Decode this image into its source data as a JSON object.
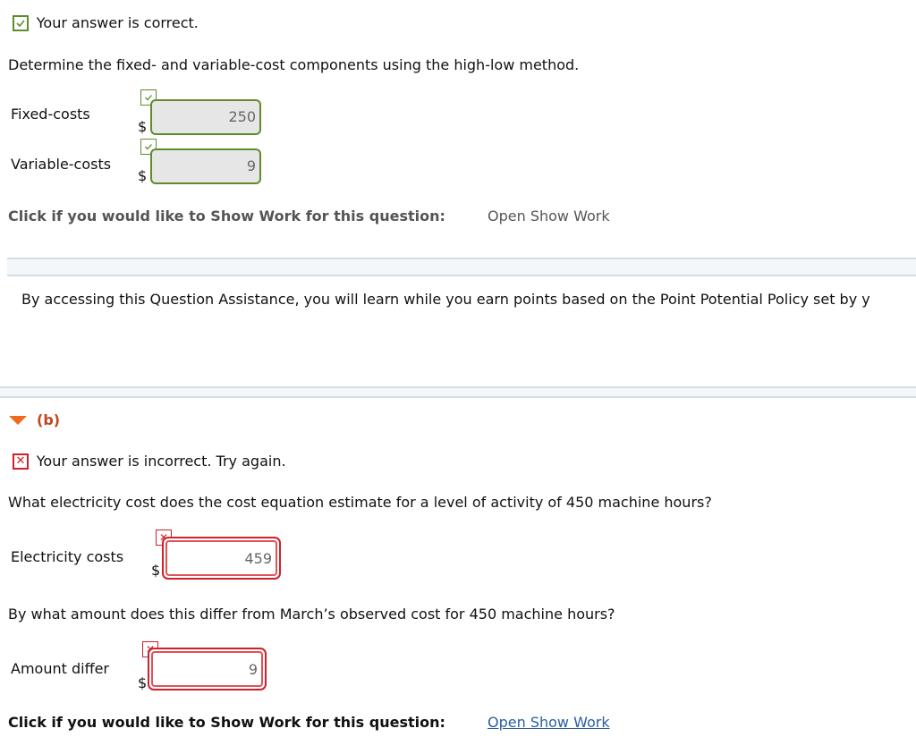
{
  "part_a": {
    "result_text": "Your answer is correct.",
    "question": "Determine the fixed- and variable-cost components using the high-low method.",
    "fields": [
      {
        "label": "Fixed-costs",
        "currency": "$",
        "value": "250",
        "status": "correct"
      },
      {
        "label": "Variable-costs",
        "currency": "$",
        "value": "9",
        "status": "correct"
      }
    ],
    "show_work_prompt": "Click if you would like to Show Work for this question:",
    "show_work_link": "Open Show Work"
  },
  "assistance": {
    "text": "By accessing this Question Assistance, you will learn while you earn points based on the Point Potential Policy set by y"
  },
  "part_b": {
    "header": "(b)",
    "result_text": "Your answer is incorrect.  Try again.",
    "question1": "What electricity cost does the cost equation estimate for a level of activity of 450 machine hours?",
    "field1": {
      "label": "Electricity costs",
      "currency": "$",
      "value": "459",
      "status": "incorrect"
    },
    "question2": "By what amount does this differ from March’s observed cost for 450 machine hours?",
    "field2": {
      "label": "Amount differ",
      "currency": "$",
      "value": "9",
      "status": "incorrect"
    },
    "show_work_prompt": "Click if you would like to Show Work for this question:",
    "show_work_link": "Open Show Work"
  },
  "colors": {
    "correct": "#5e8c2c",
    "incorrect": "#d0202a",
    "section_header": "#c0461e",
    "link": "#2a5f9e"
  }
}
